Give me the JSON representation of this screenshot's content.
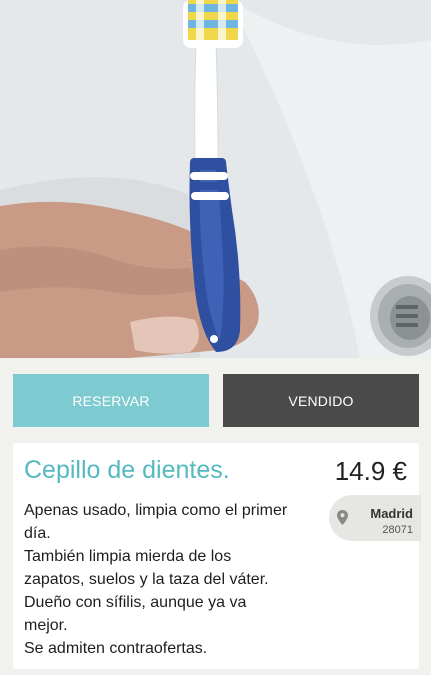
{
  "buttons": {
    "reserve_label": "RESERVAR",
    "sold_label": "VENDIDO"
  },
  "product": {
    "title": "Cepillo de dientes.",
    "price": "14.9 €",
    "description_lines": [
      "Apenas usado, limpia como el primer",
      "día.",
      "También limpia mierda de los",
      "zapatos, suelos y la taza del váter.",
      "Dueño con sífilis, aunque ya va",
      "mejor.",
      "Se admiten contraofertas."
    ]
  },
  "location": {
    "city": "Madrid",
    "zip": "28071",
    "icon": "map-pin-icon"
  },
  "gallery": {
    "pages": 1,
    "current": 1
  },
  "colors": {
    "reserve": "#7ecad1",
    "sold": "#4a4a4a",
    "title": "#55b9c1"
  }
}
